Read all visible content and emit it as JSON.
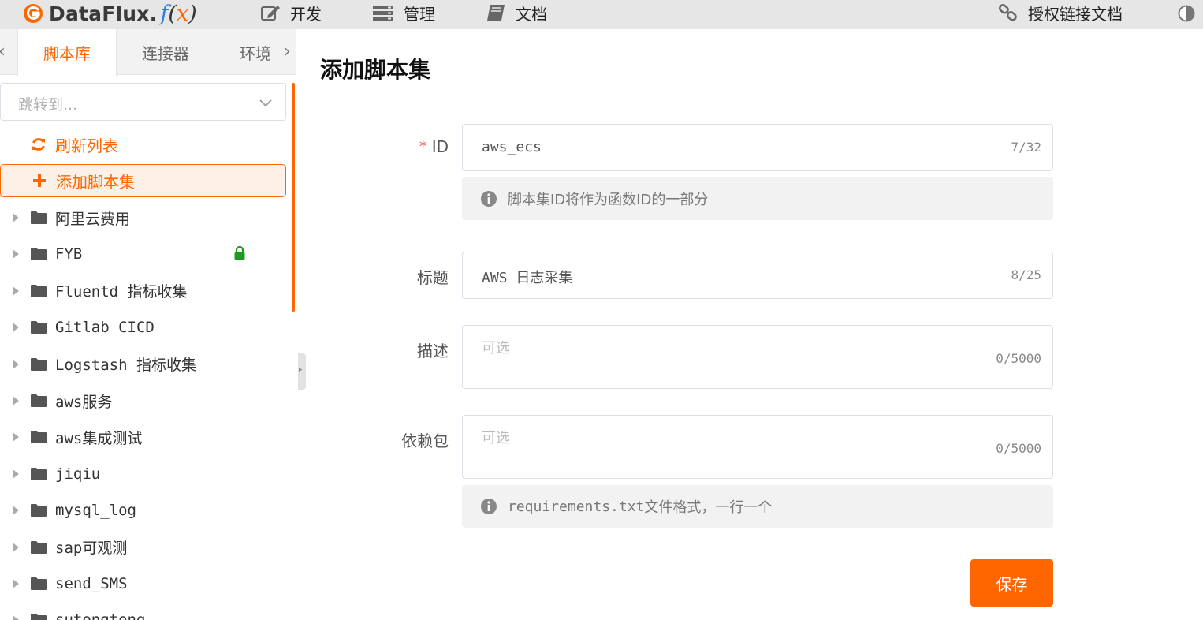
{
  "brand": {
    "name": "DataFlux.",
    "fx_f": "f",
    "fx_open": "(",
    "fx_x": "x",
    "fx_close": ")",
    "accent": "#ff6600"
  },
  "nav": {
    "items": [
      {
        "label": "开发",
        "icon": "edit-icon"
      },
      {
        "label": "管理",
        "icon": "server-icon"
      },
      {
        "label": "文档",
        "icon": "book-icon"
      }
    ],
    "auth_docs": {
      "label": "授权链接文档",
      "icon": "link-icon"
    },
    "theme_icon": "contrast-icon"
  },
  "sidebar": {
    "tabs": [
      {
        "label": "脚本库",
        "active": true
      },
      {
        "label": "连接器",
        "active": false
      },
      {
        "label": "环境",
        "active": false
      }
    ],
    "jump": {
      "placeholder": "跳转到..."
    },
    "actions": {
      "refresh": {
        "label": "刷新列表",
        "icon": "refresh-icon"
      },
      "add": {
        "label": "添加脚本集",
        "icon": "plus-icon"
      }
    },
    "tree": [
      {
        "label": "阿里云费用"
      },
      {
        "label": "FYB",
        "locked": true
      },
      {
        "label": "Fluentd 指标收集"
      },
      {
        "label": "Gitlab CICD"
      },
      {
        "label": "Logstash 指标收集"
      },
      {
        "label": "aws服务"
      },
      {
        "label": "aws集成测试"
      },
      {
        "label": "jiqiu"
      },
      {
        "label": "mysql_log"
      },
      {
        "label": "sap可观测"
      },
      {
        "label": "send_SMS"
      },
      {
        "label": "sutongtong"
      }
    ]
  },
  "form": {
    "title": "添加脚本集",
    "id": {
      "required_mark": "*",
      "label": "ID",
      "value": "aws_ecs",
      "count": "7/32",
      "hint": "脚本集ID将作为函数ID的一部分"
    },
    "title_field": {
      "label": "标题",
      "value": "AWS 日志采集",
      "count": "8/25"
    },
    "description": {
      "label": "描述",
      "placeholder": "可选",
      "count": "0/5000"
    },
    "requirements": {
      "label": "依赖包",
      "placeholder": "可选",
      "count": "0/5000",
      "hint_file": "requirements.txt",
      "hint_rest": " 文件格式，一行一个"
    },
    "save_label": "保存"
  }
}
